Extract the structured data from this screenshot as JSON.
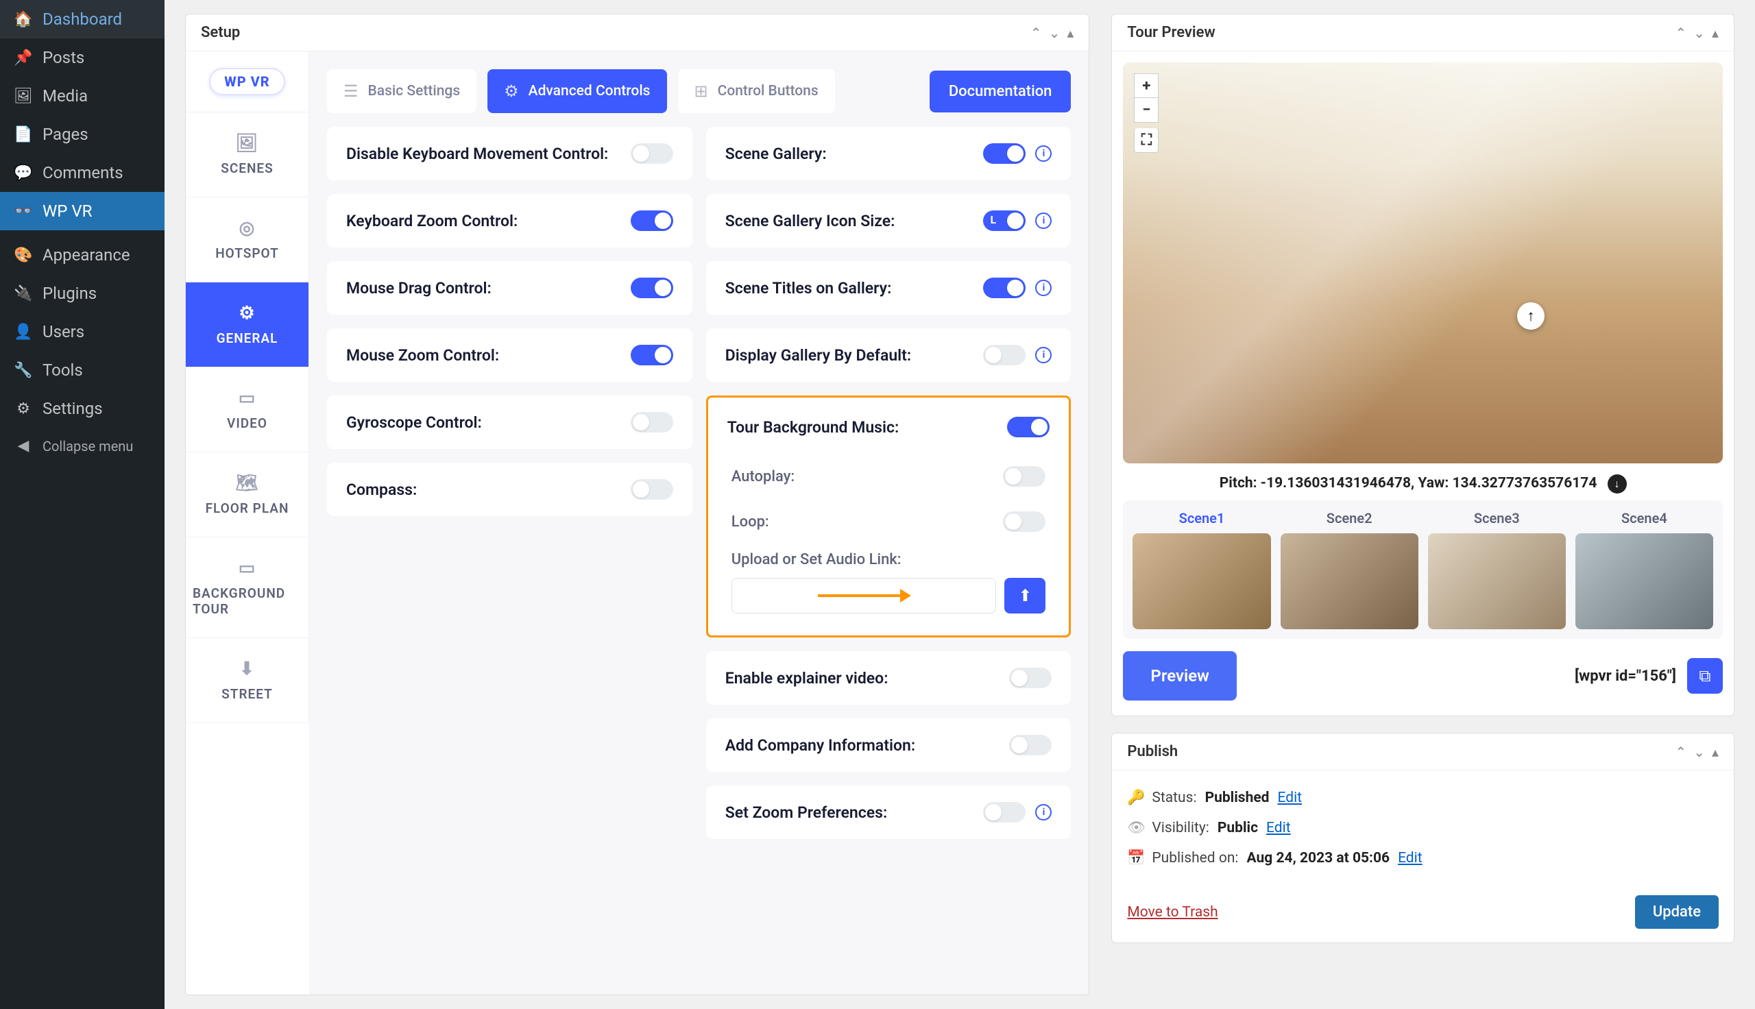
{
  "wp_menu": {
    "dashboard": "Dashboard",
    "posts": "Posts",
    "media": "Media",
    "pages": "Pages",
    "comments": "Comments",
    "wpvr": "WP VR",
    "appearance": "Appearance",
    "plugins": "Plugins",
    "users": "Users",
    "tools": "Tools",
    "settings": "Settings",
    "collapse": "Collapse menu"
  },
  "setup": {
    "title": "Setup",
    "logo_text": "WP VR",
    "vtabs": {
      "scenes": "SCENES",
      "hotspot": "HOTSPOT",
      "general": "GENERAL",
      "video": "VIDEO",
      "floorplan": "FLOOR PLAN",
      "bgtour": "BACKGROUND TOUR",
      "street": "STREET"
    },
    "top_tabs": {
      "basic": "Basic Settings",
      "advanced": "Advanced Controls",
      "control_buttons": "Control Buttons",
      "documentation": "Documentation"
    },
    "left_settings": {
      "disable_kb_move": "Disable Keyboard Movement Control:",
      "kb_zoom": "Keyboard Zoom Control:",
      "mouse_drag": "Mouse Drag Control:",
      "mouse_zoom": "Mouse Zoom Control:",
      "gyro": "Gyroscope Control:",
      "compass": "Compass:"
    },
    "right_settings": {
      "scene_gallery": "Scene Gallery:",
      "scene_gallery_icon_size": "Scene Gallery Icon Size:",
      "size_letter": "L",
      "scene_titles": "Scene Titles on Gallery:",
      "display_gallery_default": "Display Gallery By Default:",
      "tour_bgm": "Tour Background Music:",
      "autoplay": "Autoplay:",
      "loop": "Loop:",
      "upload_audio": "Upload or Set Audio Link:",
      "audio_value": "",
      "enable_explainer": "Enable explainer video:",
      "add_company": "Add Company Information:",
      "set_zoom": "Set Zoom Preferences:"
    }
  },
  "preview": {
    "title": "Tour Preview",
    "pitch_yaw": "Pitch: -19.136031431946478, Yaw: 134.32773763576174",
    "scenes": [
      "Scene1",
      "Scene2",
      "Scene3",
      "Scene4"
    ],
    "preview_btn": "Preview",
    "shortcode": "[wpvr id=\"156\"]"
  },
  "publish": {
    "title": "Publish",
    "status_label": "Status: ",
    "status_value": "Published",
    "visibility_label": "Visibility: ",
    "visibility_value": "Public",
    "published_on_label": "Published on: ",
    "published_on_value": "Aug 24, 2023 at 05:06",
    "edit": "Edit",
    "trash": "Move to Trash",
    "update": "Update"
  }
}
